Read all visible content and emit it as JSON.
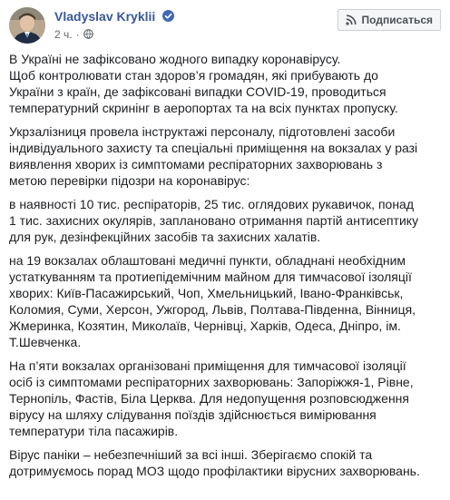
{
  "author": {
    "name": "Vladyslav Kryklii",
    "time": "2 ч.",
    "dot": "·"
  },
  "actions": {
    "subscribe_label": "Подписаться"
  },
  "icons": {
    "verified": "verified-badge-icon",
    "privacy": "globe-icon",
    "subscribe": "rss-icon"
  },
  "colors": {
    "author_name": "#385898",
    "verified_badge": "#4267b2",
    "text": "#1c1e21",
    "meta": "#616770"
  },
  "post": {
    "paragraphs": [
      [
        "В Україні не зафіксовано жодного випадку коронавірусу.",
        "Щоб контролювати стан здоров’я громадян, які прибувають до",
        "України з країн, де зафіксовані випадки COVID-19, проводиться",
        "температурний скринінг в аеропортах та на всіх пунктах пропуску."
      ],
      [
        "Укрзалізниця провела інструктажі персоналу, підготовлені засоби",
        "індивідуального захисту та спеціальні приміщення на вокзалах у разі",
        "виявлення хворих із симптомами респіраторних захворювань з",
        "метою перевірки підозри на коронавірус:"
      ],
      [
        "в наявності 10 тис. респіраторів, 25 тис. оглядових рукавичок, понад",
        "1 тис. захисних окулярів, заплановано отримання партій антисептику",
        "для рук, дезінфекційних засобів та захисних халатів."
      ],
      [
        "на 19 вокзалах облаштовані медичні пункти, обладнані необхідним",
        "устаткуванням та протиепідемічним майном для тимчасової ізоляції",
        "хворих: Київ-Пасажирський, Чоп, Хмельницький, Івано-Франківськ,",
        "Коломия, Суми, Херсон, Ужгород, Львів, Полтава-Південна, Вінниця,",
        "Жмеринка, Козятин, Миколаїв, Чернівці, Харків, Одеса, Дніпро, ім.",
        "Т.Шевченка."
      ],
      [
        "На п’яти вокзалах організовані приміщення для тимчасової ізоляції",
        "осіб із симптомами респіраторних захворювань: Запоріжжя-1, Рівне,",
        "Тернопіль, Фастів, Біла Церква. Для недопущення розповсюдження",
        "вірусу на шляху слідування поїздів здійснюється вимірювання",
        "температури тіла пасажирів."
      ],
      [
        "Вірус паніки – небезпечніший за всі інші. Зберігаємо спокій та",
        "дотримуємось порад МОЗ щодо профілактики вірусних захворювань."
      ]
    ]
  }
}
